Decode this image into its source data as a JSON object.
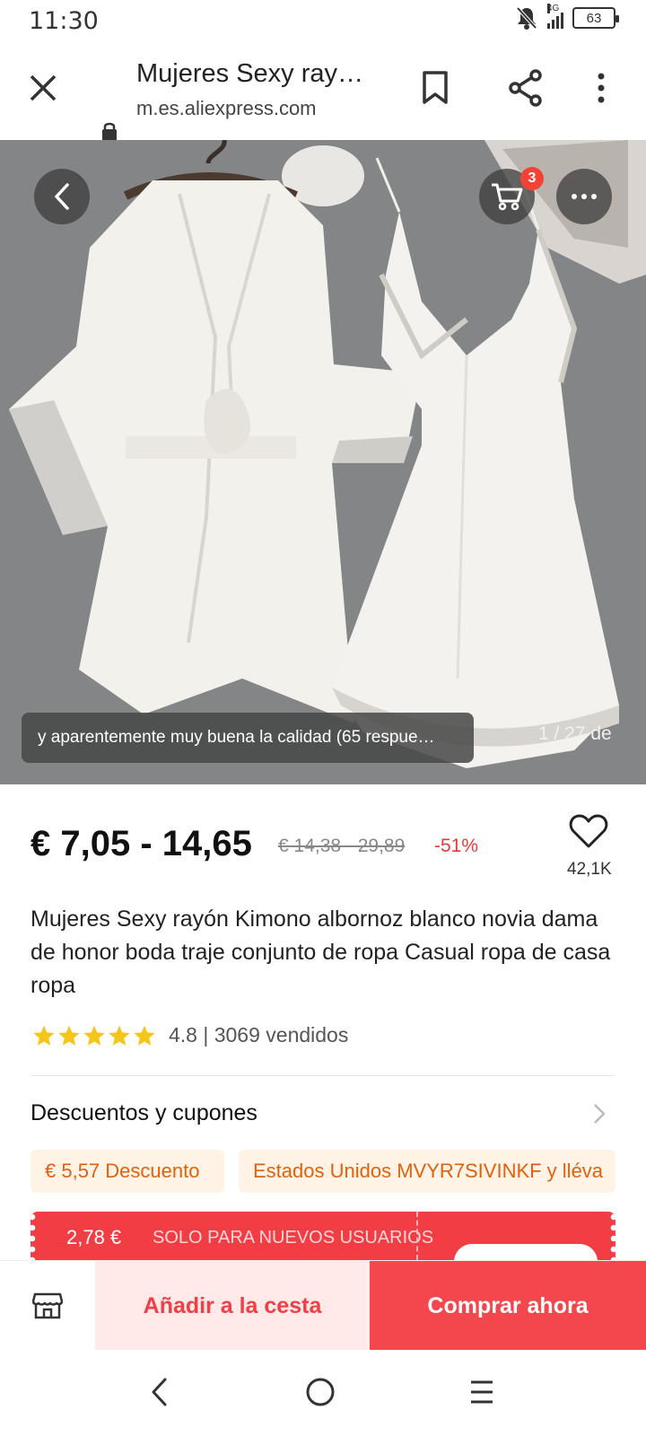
{
  "status_bar": {
    "time": "11:30",
    "network": "4G",
    "battery": "63",
    "icons": [
      "mute-notifications-icon",
      "signal-icon",
      "battery-icon"
    ]
  },
  "browser": {
    "page_title": "Mujeres Sexy ray…",
    "url": "m.es.aliexpress.com",
    "icons": [
      "close-icon",
      "lock-icon",
      "bookmark-icon",
      "share-icon",
      "more-vertical-icon"
    ]
  },
  "gallery": {
    "cart_badge": "3",
    "review_toast": "y aparentemente muy buena la calidad (65 respue…",
    "counter": "1 / 27 de",
    "icons": [
      "back-icon",
      "cart-icon",
      "more-horizontal-icon"
    ]
  },
  "product": {
    "price": "€ 7,05 - 14,65",
    "original_price": "€ 14,38 - 29,89",
    "discount": "-51%",
    "wishlist_count": "42,1K",
    "title": "Mujeres Sexy rayón Kimono albornoz blanco novia dama de honor boda traje conjunto de ropa Casual ropa de casa ropa",
    "rating": {
      "stars": 5,
      "text": "4.8 | 3069 vendidos"
    }
  },
  "coupons": {
    "heading": "Descuentos y cupones",
    "chips": [
      "€ 5,57 Descuento",
      "Estados Unidos MVYR7SIVINKF y lléva"
    ]
  },
  "new_user_banner": {
    "amount": "2,78 €",
    "label": "SOLO PARA NUEVOS USUARIOS"
  },
  "actions": {
    "add_to_cart": "Añadir a la cesta",
    "buy_now": "Comprar ahora"
  },
  "colors": {
    "accent": "#f4474d",
    "coupon_text": "#e0620e",
    "coupon_bg": "#fff3e5",
    "star": "#f5c518"
  }
}
